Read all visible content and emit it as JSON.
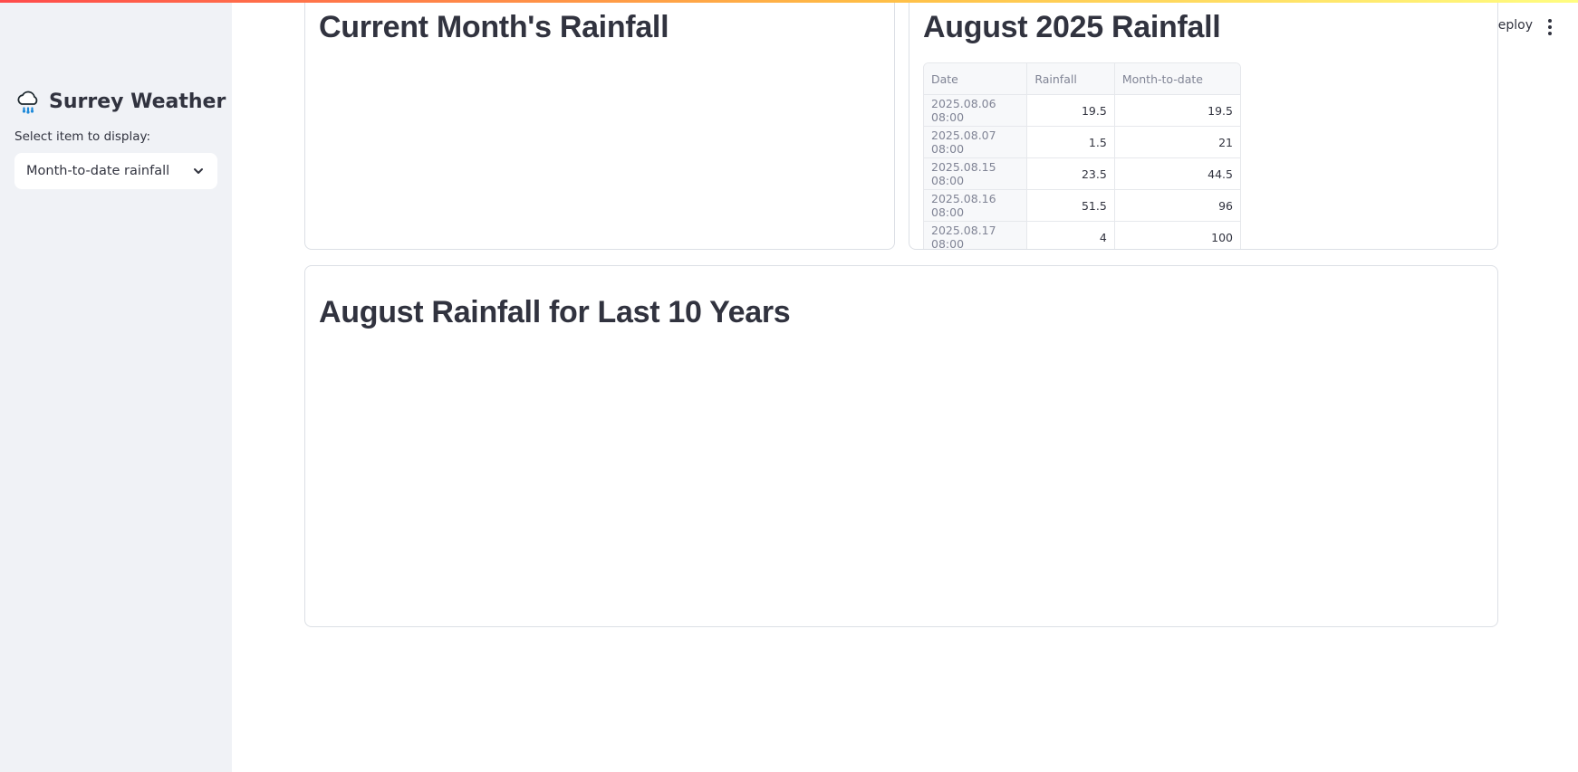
{
  "sidebar": {
    "title": "Surrey Weather",
    "select_label": "Select item to display:",
    "select_value": "Month-to-date rainfall"
  },
  "header": {
    "deploy_label": "Deploy"
  },
  "cards": {
    "current_month_title": "Current Month's Rainfall",
    "month_table_title": "August 2025 Rainfall",
    "history_title": "August Rainfall for Last 10 Years"
  },
  "table": {
    "columns": [
      "Date",
      "Rainfall",
      "Month-to-date"
    ],
    "rows": [
      [
        "2025.08.06 08:00",
        "19.5",
        "19.5"
      ],
      [
        "2025.08.07 08:00",
        "1.5",
        "21"
      ],
      [
        "2025.08.15 08:00",
        "23.5",
        "44.5"
      ],
      [
        "2025.08.16 08:00",
        "51.5",
        "96"
      ],
      [
        "2025.08.17 08:00",
        "4",
        "100"
      ]
    ]
  },
  "icons": {
    "app_icon": "rain-cloud-icon",
    "select_chevron": "chevron-down-icon",
    "main_menu": "more-vertical-icon"
  },
  "colors": {
    "sidebar_bg": "#f0f2f6",
    "text": "#31333f",
    "muted": "#808495",
    "decoration_start": "#ff4b4b",
    "decoration_end": "#fffd80"
  }
}
